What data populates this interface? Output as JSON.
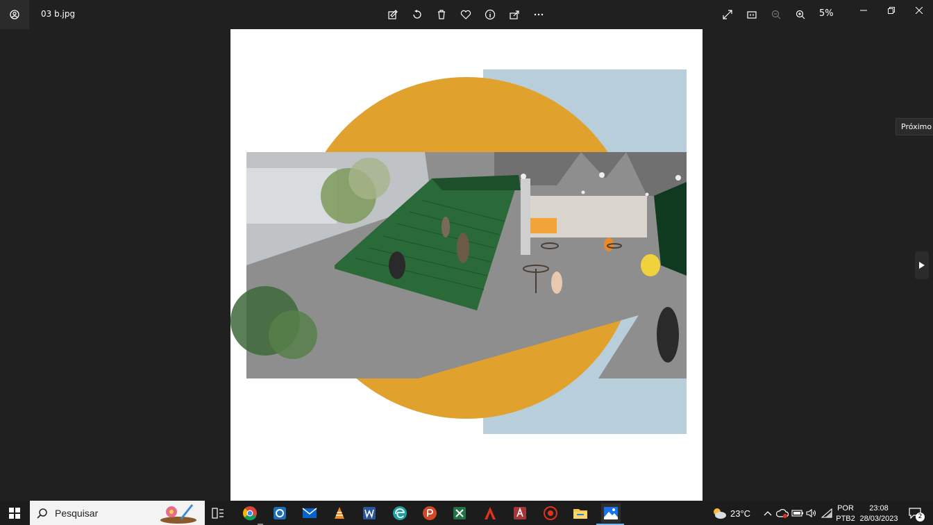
{
  "window": {
    "file_name": "03 b.jpg",
    "zoom": "5%"
  },
  "toolbar": {
    "icons": [
      "edit-image-icon",
      "rotate-icon",
      "delete-icon",
      "favorite-icon",
      "info-icon",
      "share-icon",
      "more-icon"
    ],
    "right_icons": [
      "expand-icon",
      "fit-icon",
      "zoom-out-icon",
      "zoom-in-icon"
    ]
  },
  "nav": {
    "next_tooltip": "Próximo"
  },
  "taskbar": {
    "search_placeholder": "Pesquisar",
    "weather_temp": "23°C",
    "language": "POR",
    "layout": "PTB2",
    "time": "23:08",
    "date": "28/03/2023",
    "notification_count": "2"
  },
  "colors": {
    "ochre": "#E0A12D",
    "sky": "#B8CFDB",
    "green_stair": "#2A6A38",
    "floor": "#8C8C8C"
  }
}
